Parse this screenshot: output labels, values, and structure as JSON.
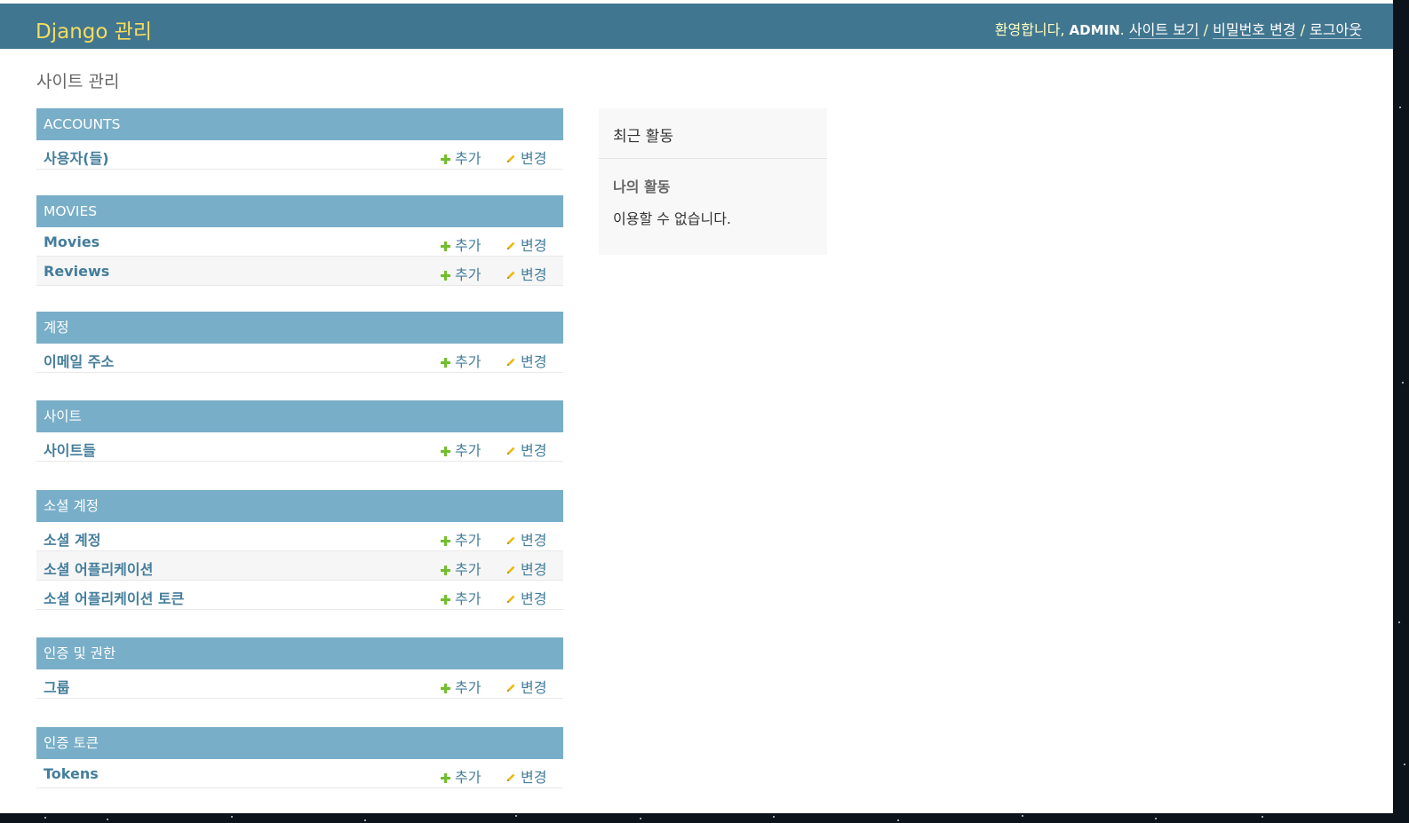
{
  "header": {
    "branding": "Django 관리",
    "welcome": "환영합니다,",
    "username": "ADMIN",
    "period": ".",
    "view_site": "사이트 보기",
    "sep": "/",
    "password_change": "비밀번호 변경",
    "logout": "로그아웃"
  },
  "page_title": "사이트 관리",
  "row_actions": {
    "add": "추가",
    "change": "변경"
  },
  "modules": [
    {
      "caption": "ACCOUNTS",
      "models": [
        {
          "name": "사용자(들)"
        }
      ]
    },
    {
      "caption": "MOVIES",
      "models": [
        {
          "name": "Movies"
        },
        {
          "name": "Reviews"
        }
      ]
    },
    {
      "caption": "계정",
      "models": [
        {
          "name": "이메일 주소"
        }
      ]
    },
    {
      "caption": "사이트",
      "models": [
        {
          "name": "사이트들"
        }
      ]
    },
    {
      "caption": "소셜 계정",
      "models": [
        {
          "name": "소셜 계정"
        },
        {
          "name": "소셜 어플리케이션"
        },
        {
          "name": "소셜 어플리케이션 토큰"
        }
      ]
    },
    {
      "caption": "인증 및 권한",
      "models": [
        {
          "name": "그룹"
        }
      ]
    },
    {
      "caption": "인증 토큰",
      "models": [
        {
          "name": "Tokens"
        }
      ]
    }
  ],
  "recent_actions": {
    "title": "최근 활동",
    "my_actions": "나의 활동",
    "empty": "이용할 수 없습니다."
  },
  "colors": {
    "header_bg": "#417690",
    "branding": "#f5dd5d",
    "module_caption_bg": "#79aec8",
    "link": "#447e9b",
    "add_icon": "#70bf2b",
    "change_icon": "#efb80b"
  }
}
